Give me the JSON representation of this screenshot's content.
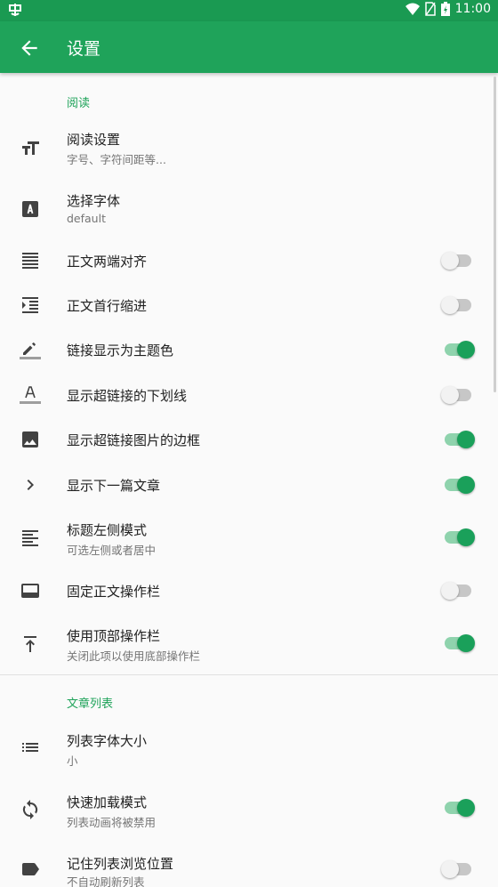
{
  "status_bar": {
    "time": "11:00"
  },
  "app_bar": {
    "title": "设置"
  },
  "sections": [
    {
      "header": "阅读"
    },
    {
      "header": "文章列表"
    }
  ],
  "items": [
    {
      "title": "阅读设置",
      "subtitle": "字号、字符间距等...",
      "icon": "text-size-icon"
    },
    {
      "title": "选择字体",
      "subtitle": "default",
      "icon": "font-box-icon"
    },
    {
      "title": "正文两端对齐",
      "icon": "justify-icon",
      "toggle": false
    },
    {
      "title": "正文首行缩进",
      "icon": "indent-icon",
      "toggle": false
    },
    {
      "title": "链接显示为主题色",
      "icon": "pencil-icon",
      "toggle": true
    },
    {
      "title": "显示超链接的下划线",
      "icon": "underline-text-icon",
      "toggle": false
    },
    {
      "title": "显示超链接图片的边框",
      "icon": "image-icon",
      "toggle": true
    },
    {
      "title": "显示下一篇文章",
      "icon": "chevron-right-icon",
      "toggle": true
    },
    {
      "title": "标题左侧模式",
      "subtitle": "可选左侧或者居中",
      "icon": "align-left-icon",
      "toggle": true
    },
    {
      "title": "固定正文操作栏",
      "icon": "bottom-bar-icon",
      "toggle": false
    },
    {
      "title": "使用顶部操作栏",
      "subtitle": "关闭此项以使用底部操作栏",
      "icon": "align-top-icon",
      "toggle": true
    },
    {
      "title": "列表字体大小",
      "subtitle": "小",
      "icon": "list-icon"
    },
    {
      "title": "快速加载模式",
      "subtitle": "列表动画将被禁用",
      "icon": "sync-icon",
      "toggle": true
    },
    {
      "title": "记住列表浏览位置",
      "subtitle": "不自动刷新列表",
      "icon": "label-icon",
      "toggle": false
    }
  ],
  "colors": {
    "accent": "#1fa35a",
    "status_bar": "#1a9a52",
    "toggle_on": "#1aa05a"
  }
}
